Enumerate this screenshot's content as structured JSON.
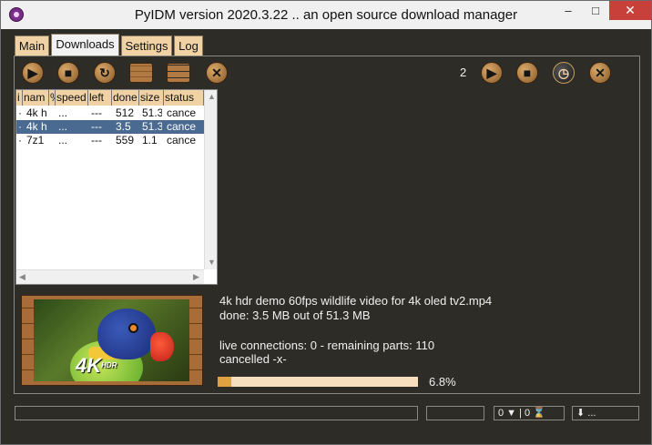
{
  "window": {
    "title": "PyIDM version 2020.3.22 .. an open source download manager",
    "minimize_glyph": "–",
    "maximize_glyph": "□",
    "close_glyph": "✕"
  },
  "tabs": [
    {
      "label": "Main",
      "active": false
    },
    {
      "label": "Downloads",
      "active": true
    },
    {
      "label": "Settings",
      "active": false
    },
    {
      "label": "Log",
      "active": false
    }
  ],
  "toolbar": {
    "left_icons": [
      "resume-icon",
      "stop-icon",
      "refresh-icon",
      "folder-icon",
      "delete-list-icon",
      "cancel-icon"
    ],
    "right_count": "2",
    "right_icons": [
      "resume-all-icon",
      "stop-all-icon",
      "schedule-icon",
      "cancel-all-icon"
    ]
  },
  "table": {
    "columns": [
      "i",
      "nam",
      "%",
      "speed",
      "left",
      "done",
      "size",
      "status"
    ],
    "rows": [
      {
        "i": "·",
        "name": "4k h",
        "percent": "",
        "speed": "...",
        "left": "---",
        "done": "512",
        "size": "51.3",
        "status": "cance",
        "selected": false
      },
      {
        "i": "·",
        "name": "4k h",
        "percent": "",
        "speed": "...",
        "left": "---",
        "done": "3.5",
        "size": "51.3",
        "status": "cance",
        "selected": true
      },
      {
        "i": "·",
        "name": "7z1",
        "percent": "",
        "speed": "...",
        "left": "---",
        "done": "559",
        "size": "1.1",
        "status": "cance",
        "selected": false
      }
    ]
  },
  "thumbnail": {
    "badge": "4K",
    "badge_small": "HDR"
  },
  "details": {
    "filename": "4k hdr demo 60fps wildlife video for 4k oled tv2.mp4",
    "done": "done: 3.5 MB out of 51.3 MB",
    "connections": "live connections: 0 - remaining parts: 110",
    "status": "cancelled  -x-"
  },
  "progress": {
    "value": 0.068,
    "label": "6.8%"
  },
  "statusbar": {
    "message": "",
    "field2": "",
    "queue": "0 ▼  |  0 ⌛",
    "speed": "⬇ ..."
  },
  "colors": {
    "background": "#2d2c26",
    "tab_inactive": "#f0d2a4",
    "progress_fill": "#e0a140",
    "progress_track": "#f5dfbf",
    "selection": "#4a6a92"
  }
}
